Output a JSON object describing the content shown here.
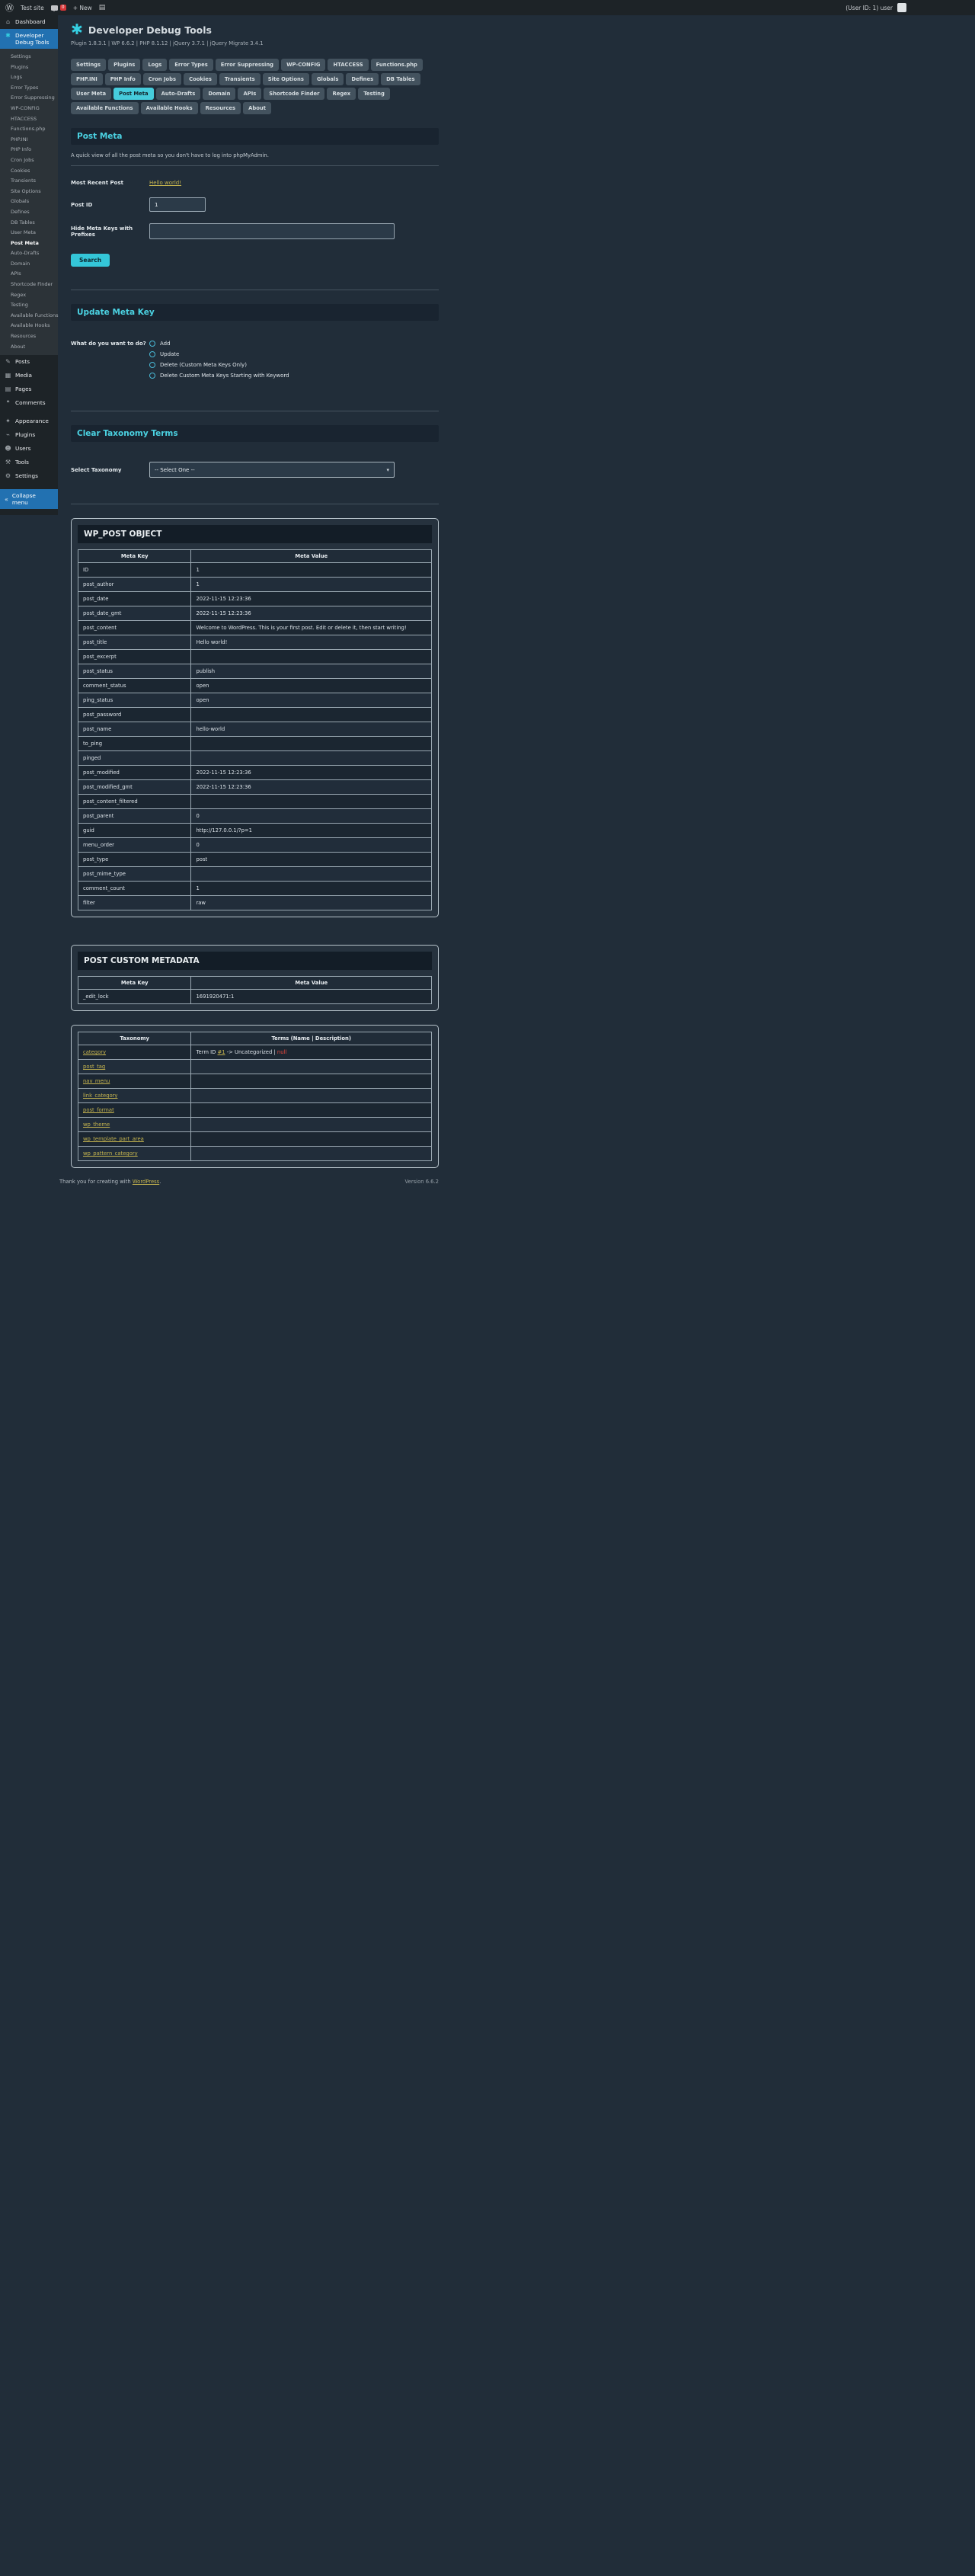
{
  "colors": {
    "accent_cyan": "#46ccdc",
    "link_yellow": "#c5b44f",
    "error_red": "#e8463c",
    "current_blue": "#2271b1"
  },
  "icons": {
    "wp_logo": "Ⓦ",
    "plus_new": "+ New",
    "page": "▤",
    "plugin_logo": "✱",
    "dashboard": "⌂",
    "posts": "✎",
    "media": "▦",
    "pages": "▤",
    "comments": "❝",
    "appearance": "✦",
    "plugins": "⌁",
    "users": "☻",
    "tools": "⚒",
    "settings": "⚙",
    "collapse": "«",
    "select_chevron": "▾"
  },
  "admin_bar": {
    "site_name": "Test site",
    "comments_count": "0",
    "new_label": "+ New",
    "user_text": "(User ID: 1) user"
  },
  "sidebar": {
    "dashboard": "Dashboard",
    "plugin_menu": "Developer Debug Tools",
    "menu": [
      {
        "label": "Posts",
        "icon": "posts"
      },
      {
        "label": "Media",
        "icon": "media"
      },
      {
        "label": "Pages",
        "icon": "pages"
      },
      {
        "label": "Comments",
        "icon": "comments"
      },
      {
        "label": "Appearance",
        "icon": "appearance",
        "sep": true
      },
      {
        "label": "Plugins",
        "icon": "plugins"
      },
      {
        "label": "Users",
        "icon": "users"
      },
      {
        "label": "Tools",
        "icon": "tools"
      },
      {
        "label": "Settings",
        "icon": "settings"
      }
    ],
    "collapse": "Collapse menu"
  },
  "sections": {
    "items": [
      "Settings",
      "Plugins",
      "Logs",
      "Error Types",
      "Error Suppressing",
      "WP-CONFIG",
      "HTACCESS",
      "Functions.php",
      "PHP.INI",
      "PHP Info",
      "Cron Jobs",
      "Cookies",
      "Transients",
      "Site Options",
      "Globals",
      "Defines",
      "DB Tables",
      "User Meta",
      "Post Meta",
      "Auto-Drafts",
      "Domain",
      "APIs",
      "Shortcode Finder",
      "Regex",
      "Testing",
      "Available Functions",
      "Available Hooks",
      "Resources",
      "About"
    ],
    "active": "Post Meta"
  },
  "header": {
    "title": "Developer Debug Tools",
    "version_line": "Plugin 1.8.3.1   |   WP 6.6.2   |   PHP 8.1.12   |   jQuery 3.7.1   |   jQuery Migrate 3.4.1"
  },
  "post_meta_section": {
    "title": "Post Meta",
    "intro": "A quick view of all the post meta so you don't have to log into phpMyAdmin.",
    "most_recent_label": "Most Recent Post",
    "most_recent_link": "Hello world!",
    "post_id_label": "Post ID",
    "post_id_value": "1",
    "hide_prefix_label": "Hide Meta Keys with Prefixes",
    "hide_prefix_value": "",
    "search_button": "Search"
  },
  "update_meta_section": {
    "title": "Update Meta Key",
    "question": "What do you want to do?",
    "options": [
      "Add",
      "Update",
      "Delete (Custom Meta Keys Only)",
      "Delete Custom Meta Keys Starting with Keyword"
    ]
  },
  "taxonomy_section": {
    "title": "Clear Taxonomy Terms",
    "select_label": "Select Taxonomy",
    "select_value": "-- Select One --"
  },
  "wp_post_object": {
    "title": "WP_POST OBJECT",
    "headers": [
      "Meta Key",
      "Meta Value"
    ],
    "rows": [
      [
        "ID",
        "1"
      ],
      [
        "post_author",
        "1"
      ],
      [
        "post_date",
        "2022-11-15 12:23:36"
      ],
      [
        "post_date_gmt",
        "2022-11-15 12:23:36"
      ],
      [
        "post_content",
        "Welcome to WordPress. This is your first post. Edit or delete it, then start writing!"
      ],
      [
        "post_title",
        "Hello world!"
      ],
      [
        "post_excerpt",
        ""
      ],
      [
        "post_status",
        "publish"
      ],
      [
        "comment_status",
        "open"
      ],
      [
        "ping_status",
        "open"
      ],
      [
        "post_password",
        ""
      ],
      [
        "post_name",
        "hello-world"
      ],
      [
        "to_ping",
        ""
      ],
      [
        "pinged",
        ""
      ],
      [
        "post_modified",
        "2022-11-15 12:23:36"
      ],
      [
        "post_modified_gmt",
        "2022-11-15 12:23:36"
      ],
      [
        "post_content_filtered",
        ""
      ],
      [
        "post_parent",
        "0"
      ],
      [
        "guid",
        "http://127.0.0.1/?p=1"
      ],
      [
        "menu_order",
        "0"
      ],
      [
        "post_type",
        "post"
      ],
      [
        "post_mime_type",
        ""
      ],
      [
        "comment_count",
        "1"
      ],
      [
        "filter",
        "raw"
      ]
    ]
  },
  "post_custom_metadata": {
    "title": "POST CUSTOM METADATA",
    "headers": [
      "Meta Key",
      "Meta Value"
    ],
    "rows": [
      [
        "_edit_lock",
        "1691920471:1"
      ]
    ]
  },
  "taxonomy_table": {
    "headers": [
      "Taxonomy",
      "Terms (Name | Description)"
    ],
    "rows": [
      {
        "taxonomy": "category",
        "terms": [
          {
            "type": "plain",
            "text": "Term ID "
          },
          {
            "type": "link",
            "text": "#1"
          },
          {
            "type": "plain",
            "text": " -> Uncategorized | "
          },
          {
            "type": "null",
            "text": "null"
          }
        ]
      },
      {
        "taxonomy": "post_tag",
        "terms": []
      },
      {
        "taxonomy": "nav_menu",
        "terms": []
      },
      {
        "taxonomy": "link_category",
        "terms": []
      },
      {
        "taxonomy": "post_format",
        "terms": []
      },
      {
        "taxonomy": "wp_theme",
        "terms": []
      },
      {
        "taxonomy": "wp_template_part_area",
        "terms": []
      },
      {
        "taxonomy": "wp_pattern_category",
        "terms": []
      }
    ]
  },
  "footer": {
    "thanks_prefix": "Thank you for creating with ",
    "thanks_link": "WordPress",
    "thanks_suffix": ".",
    "version": "Version 6.6.2"
  }
}
